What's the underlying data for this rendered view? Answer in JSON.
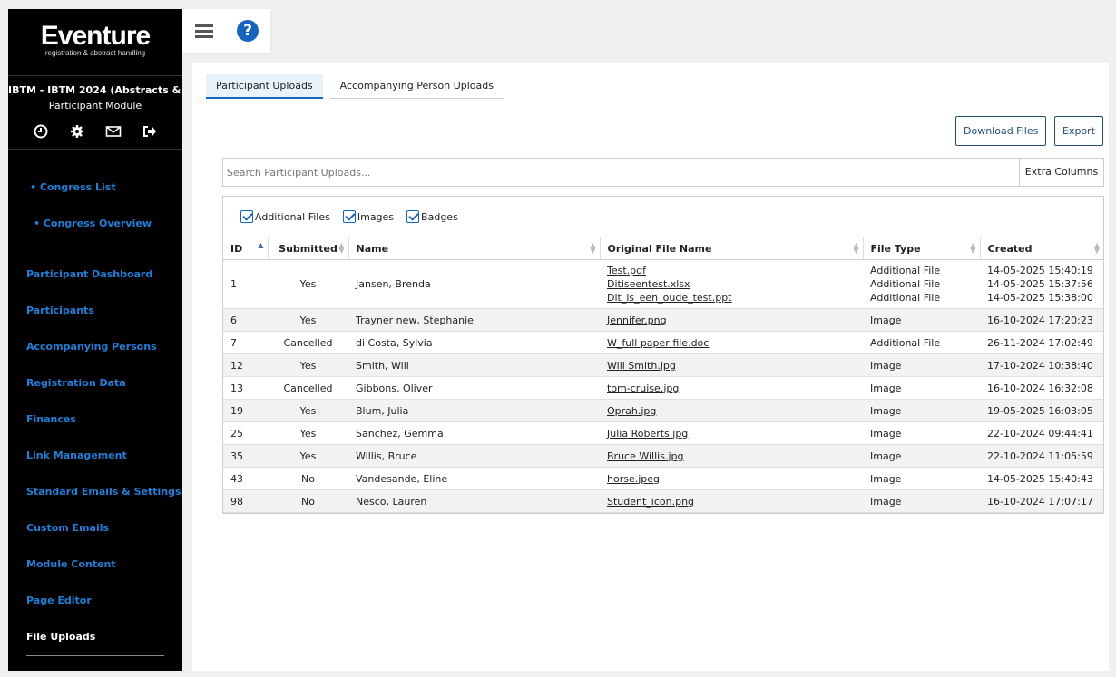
{
  "brand": {
    "name": "Eventure",
    "tagline": "registration & abstract handling"
  },
  "congress": {
    "title": "IBTM - IBTM 2024 (Abstracts & Par...",
    "module": "Participant Module"
  },
  "sidebar": {
    "sub_items": [
      "• Congress List",
      "• Congress Overview"
    ],
    "items": [
      {
        "label": "Participant Dashboard"
      },
      {
        "label": "Participants"
      },
      {
        "label": "Accompanying Persons"
      },
      {
        "label": "Registration Data"
      },
      {
        "label": "Finances"
      },
      {
        "label": "Link Management"
      },
      {
        "label": "Standard Emails & Settings"
      },
      {
        "label": "Custom Emails"
      },
      {
        "label": "Module Content"
      },
      {
        "label": "Page Editor"
      },
      {
        "label": "File Uploads"
      }
    ]
  },
  "tabs": [
    "Participant Uploads",
    "Accompanying Person Uploads"
  ],
  "toolbar": {
    "download": "Download Files",
    "export": "Export"
  },
  "search": {
    "placeholder": "Search Participant Uploads...",
    "extra": "Extra Columns"
  },
  "filters": [
    "Additional Files",
    "Images",
    "Badges"
  ],
  "table": {
    "headers": [
      "ID",
      "Submitted",
      "Name",
      "Original File Name",
      "File Type",
      "Created"
    ],
    "rows": [
      {
        "id": "1",
        "submitted": "Yes",
        "name": "Jansen, Brenda",
        "files": [
          "Test.pdf",
          "Ditiseentest.xlsx",
          "Dit_is_een_oude_test.ppt"
        ],
        "types": [
          "Additional File",
          "Additional File",
          "Additional File"
        ],
        "created": [
          "14-05-2025 15:40:19",
          "14-05-2025 15:37:56",
          "14-05-2025 15:38:00"
        ]
      },
      {
        "id": "6",
        "submitted": "Yes",
        "name": "Trayner new, Stephanie",
        "files": [
          "Jennifer.png"
        ],
        "types": [
          "Image"
        ],
        "created": [
          "16-10-2024 17:20:23"
        ]
      },
      {
        "id": "7",
        "submitted": "Cancelled",
        "name": "di Costa, Sylvia",
        "files": [
          "W_full paper file.doc"
        ],
        "types": [
          "Additional File"
        ],
        "created": [
          "26-11-2024 17:02:49"
        ]
      },
      {
        "id": "12",
        "submitted": "Yes",
        "name": "Smith, Will",
        "files": [
          "Will Smith.jpg"
        ],
        "types": [
          "Image"
        ],
        "created": [
          "17-10-2024 10:38:40"
        ]
      },
      {
        "id": "13",
        "submitted": "Cancelled",
        "name": "Gibbons, Oliver",
        "files": [
          "tom-cruise.jpg"
        ],
        "types": [
          "Image"
        ],
        "created": [
          "16-10-2024 16:32:08"
        ]
      },
      {
        "id": "19",
        "submitted": "Yes",
        "name": "Blum, Julia",
        "files": [
          "Oprah.jpg"
        ],
        "types": [
          "Image"
        ],
        "created": [
          "19-05-2025 16:03:05"
        ]
      },
      {
        "id": "25",
        "submitted": "Yes",
        "name": "Sanchez, Gemma",
        "files": [
          "Julia Roberts.jpg"
        ],
        "types": [
          "Image"
        ],
        "created": [
          "22-10-2024 09:44:41"
        ]
      },
      {
        "id": "35",
        "submitted": "Yes",
        "name": "Willis, Bruce",
        "files": [
          "Bruce Willis.jpg"
        ],
        "types": [
          "Image"
        ],
        "created": [
          "22-10-2024 11:05:59"
        ]
      },
      {
        "id": "43",
        "submitted": "No",
        "name": "Vandesande, Eline",
        "files": [
          "horse.jpeg"
        ],
        "types": [
          "Image"
        ],
        "created": [
          "14-05-2025 15:40:43"
        ]
      },
      {
        "id": "98",
        "submitted": "No",
        "name": "Nesco, Lauren",
        "files": [
          "Student_icon.png"
        ],
        "types": [
          "Image"
        ],
        "created": [
          "16-10-2024 17:07:17"
        ]
      }
    ]
  },
  "colors": {
    "accent": "#1565c0",
    "link": "#1f7fd8",
    "sidebar_bg": "#000000"
  }
}
